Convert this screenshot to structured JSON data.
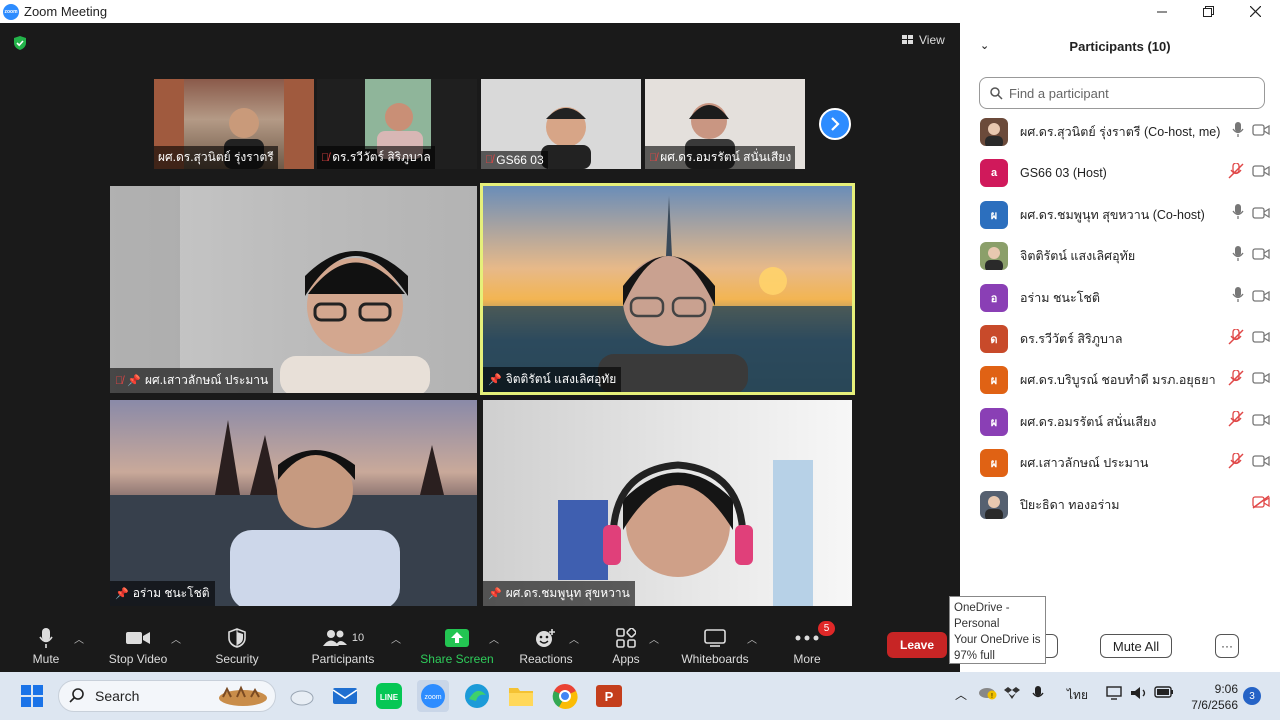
{
  "window": {
    "title": "Zoom Meeting"
  },
  "meeting": {
    "view_label": "View",
    "thumbnails": [
      {
        "name": "ผศ.ดร.สุวนิตย์ รุ่งราตรี",
        "muted": false
      },
      {
        "name": "ดร.รวีวัตร์ สิริภูบาล",
        "muted": true
      },
      {
        "name": "GS66 03",
        "muted": true
      },
      {
        "name": "ผศ.ดร.อมรรัตน์  สนั่นเสียง",
        "muted": true
      }
    ],
    "tiles": [
      {
        "name": "ผศ.เสาวลักษณ์ ประมาน",
        "muted": true,
        "pinned": true
      },
      {
        "name": "จิตติรัตน์ แสงเลิศอุทัย",
        "muted": false,
        "pinned": true,
        "active": true
      },
      {
        "name": "อร่าม ชนะโชติ",
        "muted": false,
        "pinned": true
      },
      {
        "name": "ผศ.ดร.ชมพูนุท  สุขหวาน",
        "muted": false,
        "pinned": true
      }
    ]
  },
  "toolbar": {
    "mute": "Mute",
    "stop_video": "Stop Video",
    "security": "Security",
    "participants": "Participants",
    "participants_count": "10",
    "share_screen": "Share Screen",
    "reactions": "Reactions",
    "apps": "Apps",
    "whiteboards": "Whiteboards",
    "more": "More",
    "more_badge": "5",
    "leave": "Leave"
  },
  "panel": {
    "title": "Participants (10)",
    "search_placeholder": "Find a participant",
    "participants": [
      {
        "name": "ผศ.ดร.สุวนิตย์ รุ่งราตรี (Co-host, me)",
        "avatar": "",
        "color": "#6b4a3a",
        "muted": false,
        "video_off": false
      },
      {
        "name": "GS66 03 (Host)",
        "avatar": "a",
        "color": "#d0195b",
        "muted": true,
        "video_off": false
      },
      {
        "name": "ผศ.ดร.ชมพูนุท  สุขหวาน (Co-host)",
        "avatar": "ผ",
        "color": "#2c6fbe",
        "muted": false,
        "video_off": false
      },
      {
        "name": "จิตติรัตน์ แสงเลิศอุทัย",
        "avatar": "",
        "color": "#8b9f6a",
        "muted": false,
        "video_off": false
      },
      {
        "name": "อร่าม ชนะโชติ",
        "avatar": "อ",
        "color": "#8a3fb5",
        "muted": false,
        "video_off": false
      },
      {
        "name": "ดร.รวีวัตร์ สิริภูบาล",
        "avatar": "ด",
        "color": "#c84a2a",
        "muted": true,
        "video_off": false
      },
      {
        "name": "ผศ.ดร.บริบูรณ์ ชอบทำดี มรภ.อยุธยา",
        "avatar": "ผ",
        "color": "#e06214",
        "muted": true,
        "video_off": false
      },
      {
        "name": "ผศ.ดร.อมรรัตน์  สนั่นเสียง",
        "avatar": "ผ",
        "color": "#8a3fb5",
        "muted": true,
        "video_off": false
      },
      {
        "name": "ผศ.เสาวลักษณ์ ประมาน",
        "avatar": "ผ",
        "color": "#e06214",
        "muted": true,
        "video_off": false
      },
      {
        "name": "ปิยะธิดา ทองอร่าม",
        "avatar": "",
        "color": "#556070",
        "muted": false,
        "video_off": true
      }
    ],
    "mute_all": "Mute All",
    "more": "···"
  },
  "tooltip": {
    "line1": "OneDrive -",
    "line2": "Personal",
    "line3": "Your OneDrive is",
    "line4": "97% full"
  },
  "taskbar": {
    "search": "Search",
    "lang": "ไทย",
    "time": "9:06",
    "date": "7/6/2566",
    "notifications": "3"
  }
}
